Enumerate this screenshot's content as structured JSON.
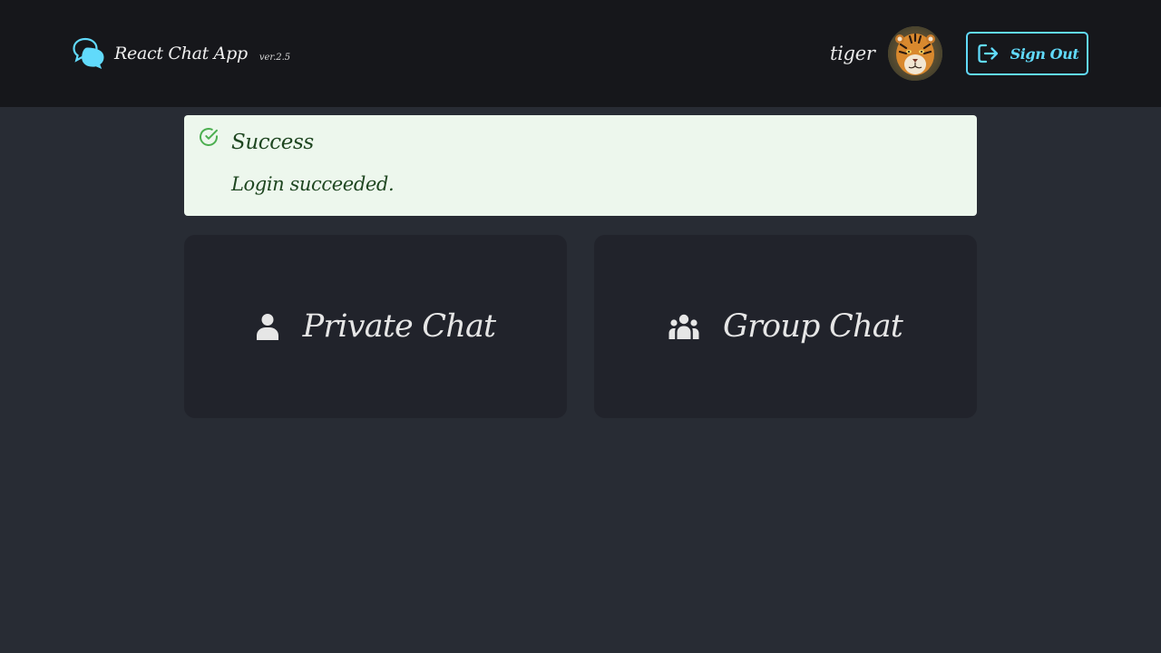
{
  "header": {
    "app_title": "React Chat App",
    "version": "ver.2.5",
    "username": "tiger",
    "sign_out_label": "Sign Out"
  },
  "alert": {
    "title": "Success",
    "message": "Login succeeded."
  },
  "cards": {
    "private_label": "Private Chat",
    "group_label": "Group Chat"
  },
  "colors": {
    "accent": "#61dafb",
    "background": "#282c34",
    "header": "#16171b",
    "card": "#21232b",
    "success_bg": "#edf7ed",
    "success_text": "#1e4620",
    "success_icon": "#4caf50"
  },
  "icons": {
    "brand": "chat-bubbles-icon",
    "sign_out": "sign-out-icon",
    "alert": "check-circle-icon",
    "private": "person-icon",
    "group": "group-icon"
  }
}
